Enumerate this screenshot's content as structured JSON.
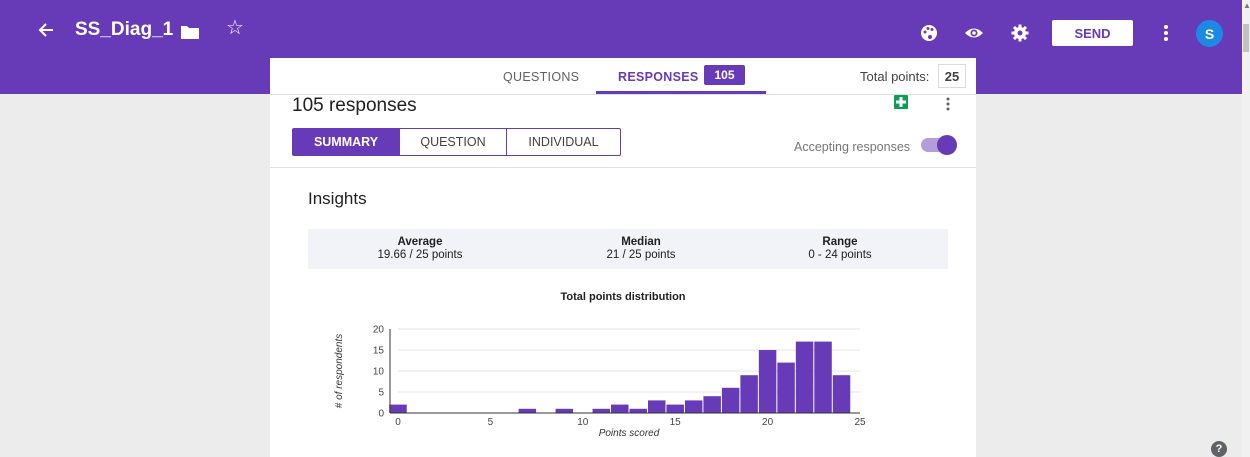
{
  "header": {
    "title": "SS_Diag_1",
    "send_label": "SEND",
    "avatar_initial": "S"
  },
  "tabs": {
    "questions": "QUESTIONS",
    "responses": "RESPONSES",
    "responses_count": "105",
    "total_points_label": "Total points:",
    "total_points_value": "25"
  },
  "summary": {
    "responses_title": "105 responses",
    "views": [
      "SUMMARY",
      "QUESTION",
      "INDIVIDUAL"
    ],
    "accepting_label": "Accepting responses",
    "accepting_on": true
  },
  "insights": {
    "title": "Insights",
    "stats": [
      {
        "label": "Average",
        "value": "19.66 / 25 points"
      },
      {
        "label": "Median",
        "value": "21 / 25 points"
      },
      {
        "label": "Range",
        "value": "0 - 24 points"
      }
    ]
  },
  "chart_data": {
    "type": "bar",
    "title": "Total points distribution",
    "xlabel": "Points scored",
    "ylabel": "# of respondents",
    "x": [
      0,
      1,
      2,
      3,
      4,
      5,
      6,
      7,
      8,
      9,
      10,
      11,
      12,
      13,
      14,
      15,
      16,
      17,
      18,
      19,
      20,
      21,
      22,
      23,
      24
    ],
    "values": [
      2,
      0,
      0,
      0,
      0,
      0,
      0,
      1,
      0,
      1,
      0,
      1,
      2,
      1,
      3,
      2,
      3,
      4,
      6,
      9,
      15,
      12,
      17,
      17,
      9
    ],
    "xticks": [
      "0",
      "5",
      "10",
      "15",
      "20",
      "25"
    ],
    "yticks": [
      "0",
      "5",
      "10",
      "15",
      "20"
    ],
    "xlim": [
      0,
      25
    ],
    "ylim": [
      0,
      20
    ],
    "grid": true,
    "bar_color": "#673ab7"
  },
  "colors": {
    "accent": "#673ab7",
    "background": "#ececec",
    "avatar": "#1e88e5"
  }
}
